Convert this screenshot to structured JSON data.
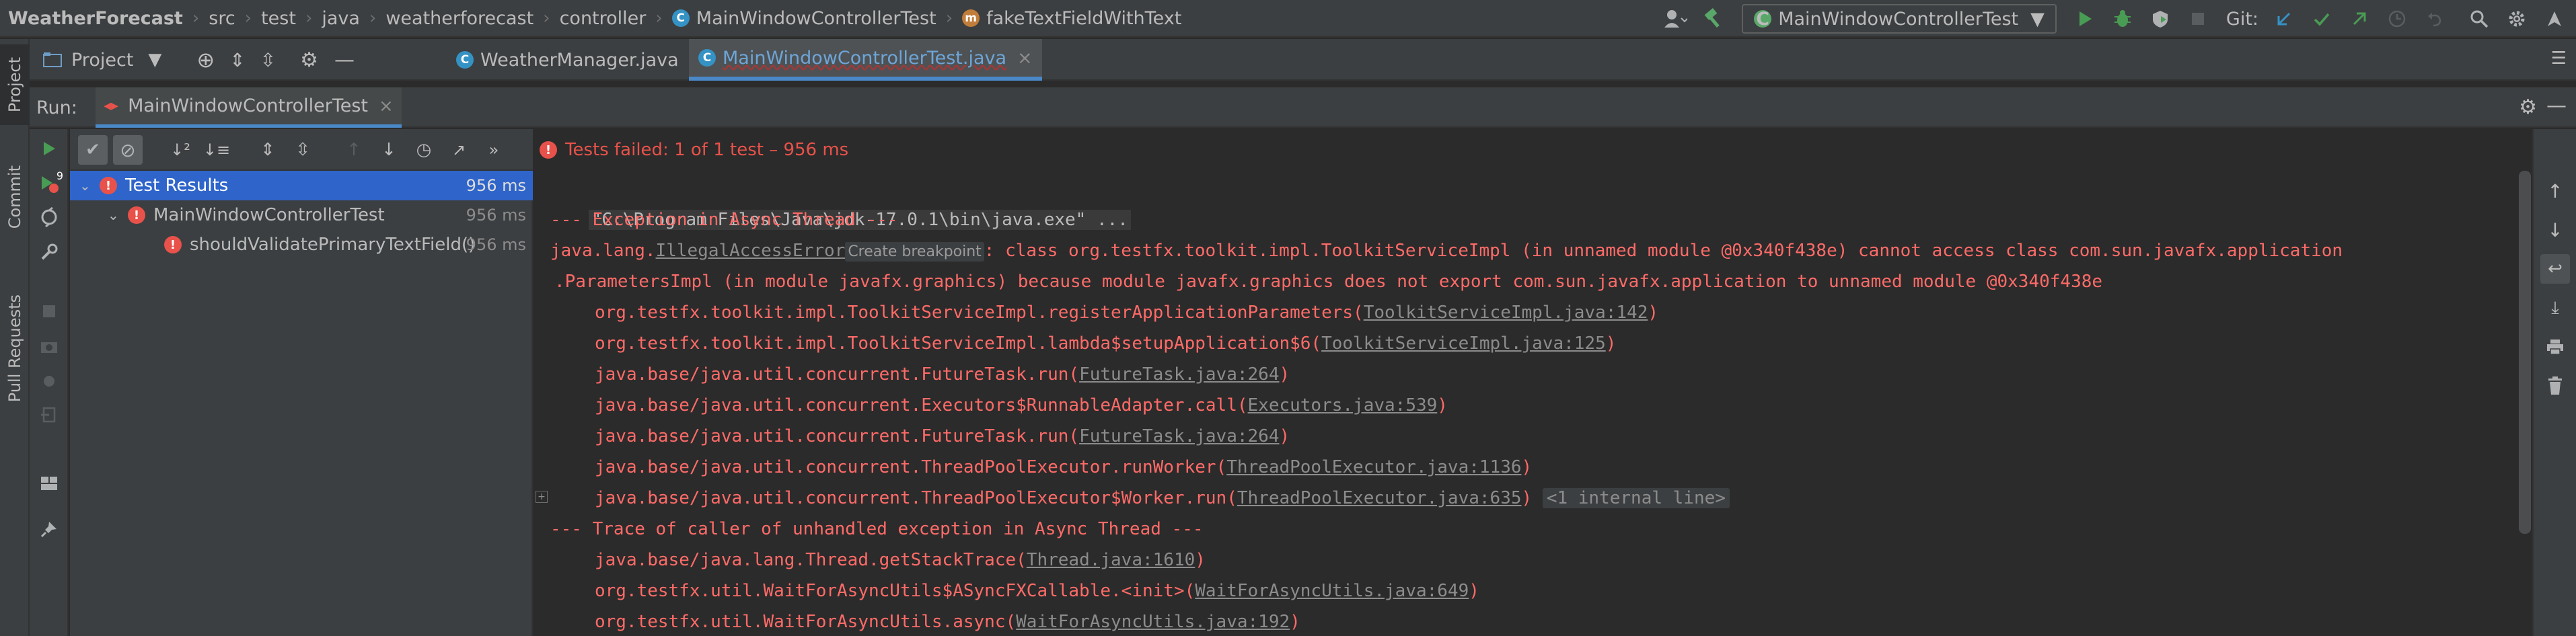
{
  "breadcrumbs": [
    {
      "label": "WeatherForecast",
      "bold": true
    },
    {
      "label": "src"
    },
    {
      "label": "test"
    },
    {
      "label": "java"
    },
    {
      "label": "weatherforecast"
    },
    {
      "label": "controller"
    },
    {
      "label": "MainWindowControllerTest",
      "icon": "class-icon"
    },
    {
      "label": "fakeTextFieldWithText",
      "icon": "method-icon"
    }
  ],
  "toolbar": {
    "run_config": "MainWindowControllerTest",
    "git_label": "Git:"
  },
  "left_strip": {
    "project_label": "Project",
    "commit_label": "Commit",
    "pull_requests_label": "Pull Requests",
    "commit_badge": "9"
  },
  "editor_tabs": {
    "project_tool_label": "Project",
    "tabs": [
      {
        "label": "WeatherManager.java",
        "active": false
      },
      {
        "label": "MainWindowControllerTest.java",
        "active": true
      }
    ]
  },
  "run": {
    "label": "Run:",
    "tab_label": "MainWindowControllerTest",
    "status": "Tests failed: 1 of 1 test – 956 ms"
  },
  "test_tree": [
    {
      "label": "Test Results",
      "time": "956 ms",
      "level": 0,
      "selected": true
    },
    {
      "label": "MainWindowControllerTest",
      "time": "956 ms",
      "level": 1,
      "selected": false
    },
    {
      "label": "shouldValidatePrimaryTextField()",
      "time": "956 ms",
      "level": 2,
      "selected": false
    }
  ],
  "console": {
    "cmd": "\"C:\\Program Files\\Java\\jdk-17.0.1\\bin\\java.exe\" ...",
    "exception_header": "--- Exception in Async Thread ---",
    "error_prefix": "java.lang.",
    "error_class": "IllegalAccessError",
    "create_breakpoint": "Create breakpoint",
    "error_msg": ": class org.testfx.toolkit.impl.ToolkitServiceImpl (in unnamed module @0x340f438e) cannot access class com.sun.javafx.application",
    "error_msg2": ".ParametersImpl (in module javafx.graphics) because module javafx.graphics does not export com.sun.javafx.application to unnamed module @0x340f438e",
    "stack": [
      {
        "text": "org.testfx.toolkit.impl.ToolkitServiceImpl.registerApplicationParameters(",
        "link": "ToolkitServiceImpl.java:142",
        "tail": ")"
      },
      {
        "text": "org.testfx.toolkit.impl.ToolkitServiceImpl.lambda$setupApplication$6(",
        "link": "ToolkitServiceImpl.java:125",
        "tail": ")"
      },
      {
        "text": "java.base/java.util.concurrent.FutureTask.run(",
        "link": "FutureTask.java:264",
        "tail": ")"
      },
      {
        "text": "java.base/java.util.concurrent.Executors$RunnableAdapter.call(",
        "link": "Executors.java:539",
        "tail": ")"
      },
      {
        "text": "java.base/java.util.concurrent.FutureTask.run(",
        "link": "FutureTask.java:264",
        "tail": ")"
      },
      {
        "text": "java.base/java.util.concurrent.ThreadPoolExecutor.runWorker(",
        "link": "ThreadPoolExecutor.java:1136",
        "tail": ")"
      },
      {
        "text": "java.base/java.util.concurrent.ThreadPoolExecutor$Worker.run(",
        "link": "ThreadPoolExecutor.java:635",
        "tail": ")",
        "internal": "<1 internal line>"
      }
    ],
    "trace_header": "--- Trace of caller of unhandled exception in Async Thread ---",
    "trace": [
      {
        "text": "java.base/java.lang.Thread.getStackTrace(",
        "link": "Thread.java:1610",
        "tail": ")"
      },
      {
        "text": "org.testfx.util.WaitForAsyncUtils$ASyncFXCallable.<init>(",
        "link": "WaitForAsyncUtils.java:649",
        "tail": ")"
      },
      {
        "text": "org.testfx.util.WaitForAsyncUtils.async(",
        "link": "WaitForAsyncUtils.java:192",
        "tail": ")"
      }
    ]
  }
}
